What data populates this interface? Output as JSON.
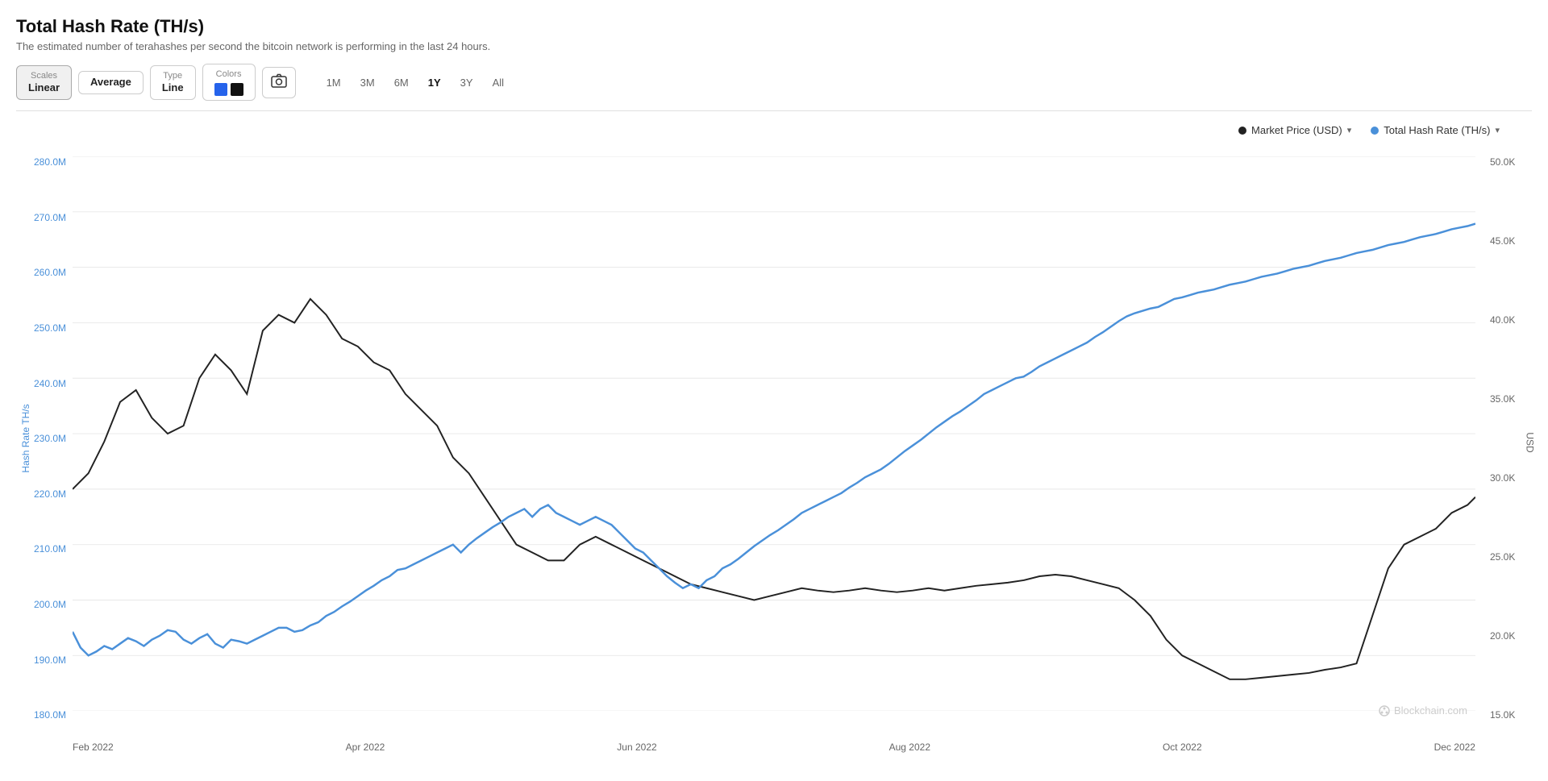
{
  "page": {
    "title": "Total Hash Rate (TH/s)",
    "subtitle": "The estimated number of terahashes per second the bitcoin network is performing in the last 24 hours."
  },
  "toolbar": {
    "scales_label": "Scales",
    "scales_value": "Linear",
    "average_label": "Average",
    "type_label": "Type",
    "type_value": "Line",
    "colors_label": "Colors",
    "color1": "#2563eb",
    "color2": "#111111",
    "camera_icon": "📷"
  },
  "time_buttons": [
    {
      "label": "1M",
      "active": false
    },
    {
      "label": "3M",
      "active": false
    },
    {
      "label": "6M",
      "active": false
    },
    {
      "label": "1Y",
      "active": true
    },
    {
      "label": "3Y",
      "active": false
    },
    {
      "label": "All",
      "active": false
    }
  ],
  "legend": [
    {
      "label": "Market Price (USD)",
      "color": "#222222",
      "type": "dot"
    },
    {
      "label": "Total Hash Rate (TH/s)",
      "color": "#4a90d9",
      "type": "dot"
    }
  ],
  "y_axis_left": {
    "label": "Hash Rate TH/s",
    "ticks": [
      "280.0M",
      "270.0M",
      "260.0M",
      "250.0M",
      "240.0M",
      "230.0M",
      "220.0M",
      "210.0M",
      "200.0M",
      "190.0M",
      "180.0M"
    ]
  },
  "y_axis_right": {
    "label": "USD",
    "ticks": [
      "50.0K",
      "45.0K",
      "40.0K",
      "35.0K",
      "30.0K",
      "25.0K",
      "20.0K",
      "15.0K"
    ]
  },
  "x_axis": {
    "ticks": [
      "Feb 2022",
      "Apr 2022",
      "Jun 2022",
      "Aug 2022",
      "Oct 2022",
      "Dec 2022"
    ]
  },
  "watermark": "Blockchain.com"
}
